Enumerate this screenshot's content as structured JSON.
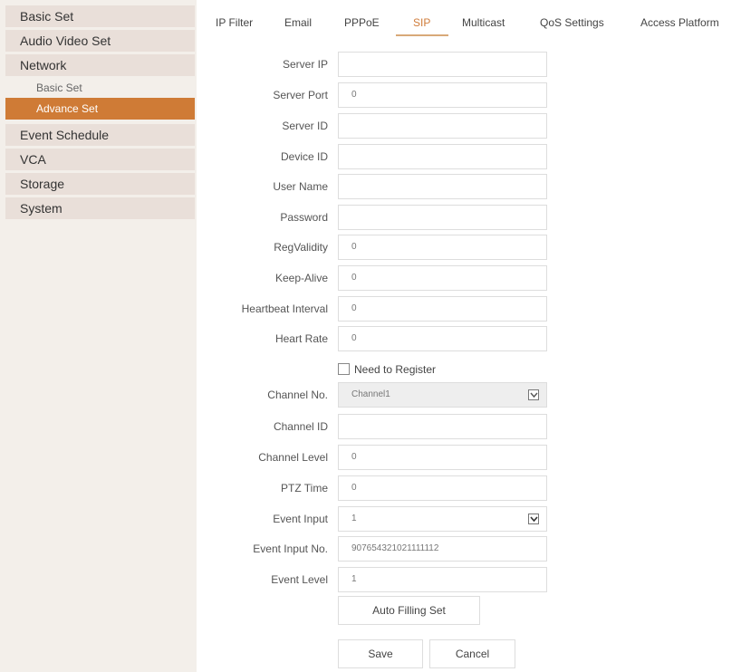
{
  "sidebar": {
    "items": [
      {
        "label": "Basic Set"
      },
      {
        "label": "Audio Video Set"
      },
      {
        "label": "Network"
      },
      {
        "label": "Event Schedule"
      },
      {
        "label": "VCA"
      },
      {
        "label": "Storage"
      },
      {
        "label": "System"
      }
    ],
    "network_sub": [
      {
        "label": "Basic Set"
      },
      {
        "label": "Advance Set",
        "active": true
      }
    ],
    "active_color": "#cf7b36"
  },
  "tabs": [
    {
      "label": "IP Filter"
    },
    {
      "label": "Email"
    },
    {
      "label": "PPPoE"
    },
    {
      "label": "SIP",
      "active": true
    },
    {
      "label": "Multicast"
    },
    {
      "label": "QoS Settings"
    },
    {
      "label": "Access Platform"
    }
  ],
  "form": {
    "server_ip": {
      "label": "Server IP",
      "value": ""
    },
    "server_port": {
      "label": "Server Port",
      "value": "0"
    },
    "server_id": {
      "label": "Server ID",
      "value": ""
    },
    "device_id": {
      "label": "Device ID",
      "value": ""
    },
    "user_name": {
      "label": "User Name",
      "value": ""
    },
    "password": {
      "label": "Password",
      "value": ""
    },
    "reg_validity": {
      "label": "RegValidity",
      "value": "0"
    },
    "keep_alive": {
      "label": "Keep-Alive",
      "value": "0"
    },
    "heartbeat_interval": {
      "label": "Heartbeat Interval",
      "value": "0"
    },
    "heart_rate": {
      "label": "Heart Rate",
      "value": "0"
    },
    "need_register": {
      "label": "Need to Register",
      "checked": false
    },
    "channel_no": {
      "label": "Channel No.",
      "value": "Channel1"
    },
    "channel_id": {
      "label": "Channel ID",
      "value": ""
    },
    "channel_level": {
      "label": "Channel Level",
      "value": "0"
    },
    "ptz_time": {
      "label": "PTZ Time",
      "value": "0"
    },
    "event_input": {
      "label": "Event Input",
      "value": "1"
    },
    "event_input_no": {
      "label": "Event Input No.",
      "value": "907654321021111112"
    },
    "event_level": {
      "label": "Event Level",
      "value": "1"
    }
  },
  "buttons": {
    "auto_filling": "Auto Filling Set",
    "save": "Save",
    "cancel": "Cancel"
  },
  "icons": {
    "select_arrow": "chevron-down-icon"
  }
}
